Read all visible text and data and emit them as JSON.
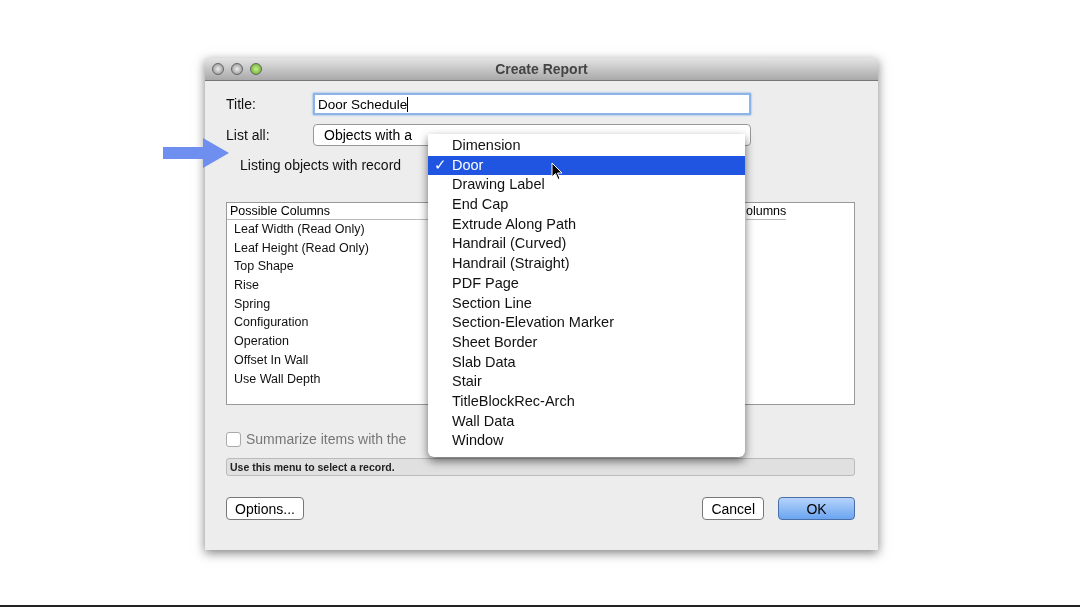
{
  "window": {
    "title": "Create Report"
  },
  "title_field": {
    "label": "Title:",
    "value": "Door Schedule"
  },
  "list_all": {
    "label": "List all:",
    "value": "Objects with a"
  },
  "record_row": {
    "label": "Listing objects with record"
  },
  "possible_columns": {
    "header": "Possible Columns",
    "items": [
      "Leaf Width (Read Only)",
      "Leaf Height (Read Only)",
      "Top Shape",
      "Rise",
      "Spring",
      "Configuration",
      "Operation",
      "Offset In Wall",
      "Use Wall Depth"
    ]
  },
  "report_columns": {
    "header": "olumns"
  },
  "summarize": {
    "label": "Summarize items with the",
    "checked": false
  },
  "status_bar": "Use this menu to select a record.",
  "buttons": [
    {
      "label": "Options...",
      "kind": "plain"
    },
    {
      "label": "Cancel",
      "kind": "plain"
    },
    {
      "label": "OK",
      "kind": "default"
    }
  ],
  "record_menu": [
    {
      "label": "Dimension",
      "selected": false
    },
    {
      "label": "Door",
      "selected": true
    },
    {
      "label": "Drawing Label",
      "selected": false
    },
    {
      "label": "End Cap",
      "selected": false
    },
    {
      "label": "Extrude Along Path",
      "selected": false
    },
    {
      "label": "Handrail (Curved)",
      "selected": false
    },
    {
      "label": "Handrail (Straight)",
      "selected": false
    },
    {
      "label": "PDF Page",
      "selected": false
    },
    {
      "label": "Section Line",
      "selected": false
    },
    {
      "label": "Section-Elevation Marker",
      "selected": false
    },
    {
      "label": "Sheet Border",
      "selected": false
    },
    {
      "label": "Slab Data",
      "selected": false
    },
    {
      "label": "Stair",
      "selected": false
    },
    {
      "label": "TitleBlockRec-Arch",
      "selected": false
    },
    {
      "label": "Wall Data",
      "selected": false
    },
    {
      "label": "Window",
      "selected": false
    }
  ],
  "check_mark": "✓"
}
